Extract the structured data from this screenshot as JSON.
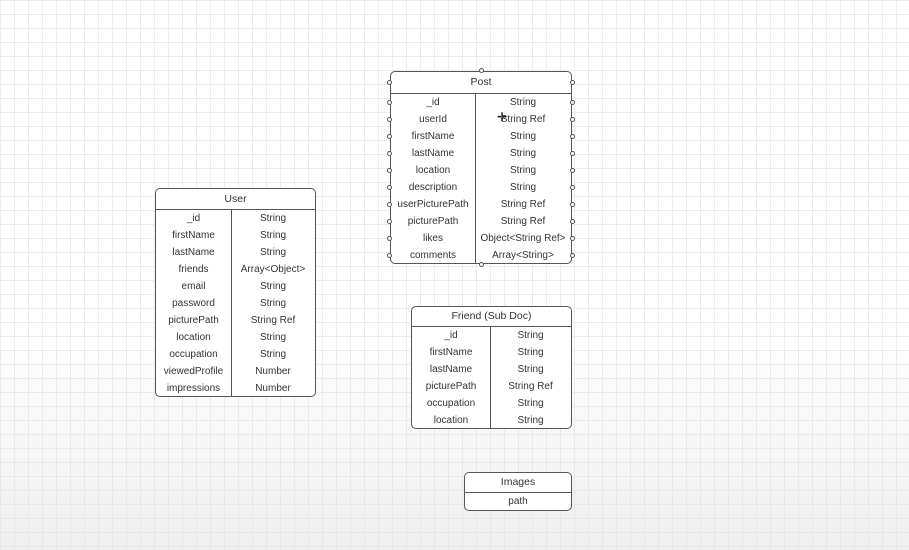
{
  "tables": [
    {
      "id": "post",
      "title": "Post",
      "rows": [
        {
          "name": "_id",
          "type": "String"
        },
        {
          "name": "userId",
          "type": "String Ref"
        },
        {
          "name": "firstName",
          "type": "String"
        },
        {
          "name": "lastName",
          "type": "String"
        },
        {
          "name": "location",
          "type": "String"
        },
        {
          "name": "description",
          "type": "String"
        },
        {
          "name": "userPicturePath",
          "type": "String Ref"
        },
        {
          "name": "picturePath",
          "type": "String Ref"
        },
        {
          "name": "likes",
          "type": "Object<String Ref>"
        },
        {
          "name": "comments",
          "type": "Array<String>"
        }
      ]
    },
    {
      "id": "user",
      "title": "User",
      "rows": [
        {
          "name": "_id",
          "type": "String"
        },
        {
          "name": "firstName",
          "type": "String"
        },
        {
          "name": "lastName",
          "type": "String"
        },
        {
          "name": "friends",
          "type": "Array<Object>"
        },
        {
          "name": "email",
          "type": "String"
        },
        {
          "name": "password",
          "type": "String"
        },
        {
          "name": "picturePath",
          "type": "String Ref"
        },
        {
          "name": "location",
          "type": "String"
        },
        {
          "name": "occupation",
          "type": "String"
        },
        {
          "name": "viewedProfile",
          "type": "Number"
        },
        {
          "name": "impressions",
          "type": "Number"
        }
      ]
    },
    {
      "id": "friend",
      "title": "Friend (Sub Doc)",
      "rows": [
        {
          "name": "_id",
          "type": "String"
        },
        {
          "name": "firstName",
          "type": "String"
        },
        {
          "name": "lastName",
          "type": "String"
        },
        {
          "name": "picturePath",
          "type": "String Ref"
        },
        {
          "name": "occupation",
          "type": "String"
        },
        {
          "name": "location",
          "type": "String"
        }
      ]
    },
    {
      "id": "images",
      "title": "Images",
      "rows": [
        {
          "name": "path"
        }
      ]
    }
  ]
}
